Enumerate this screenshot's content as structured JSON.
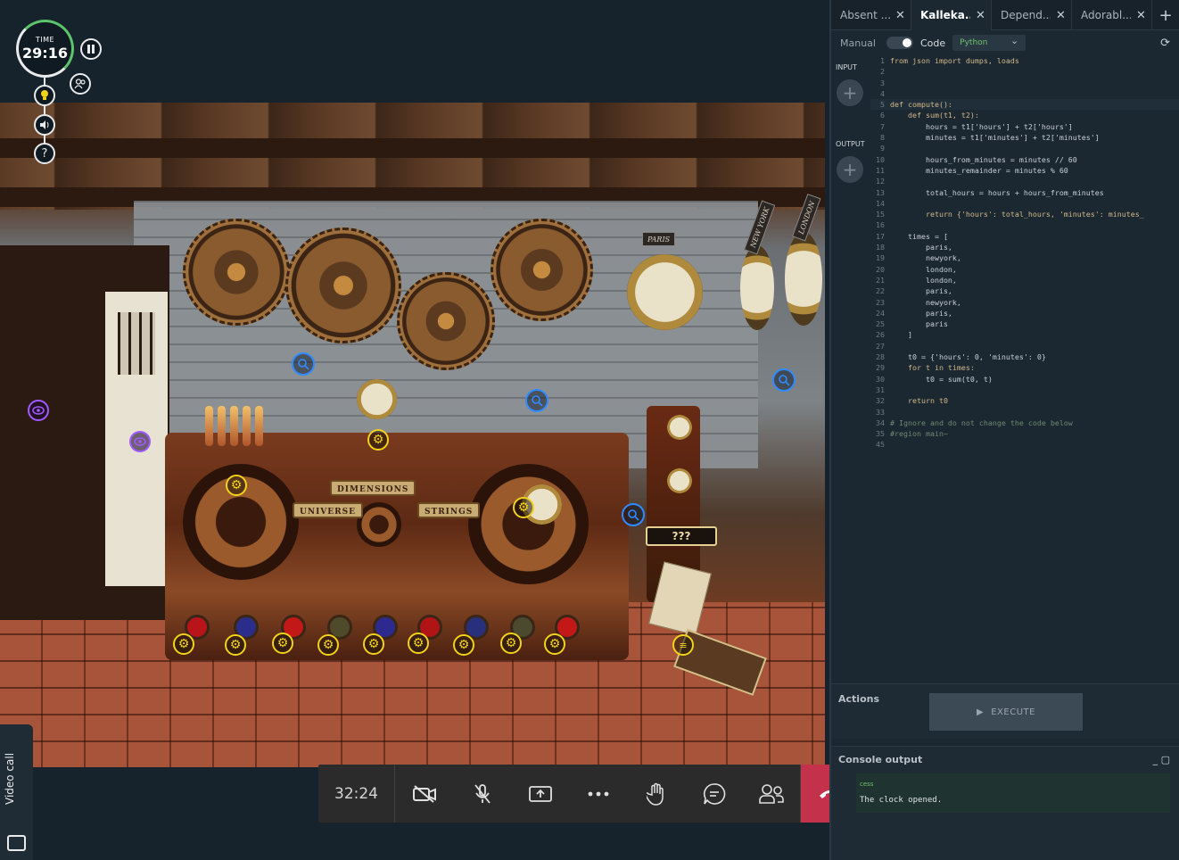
{
  "hud": {
    "timer_label": "TIME",
    "timer_value": "29:16",
    "pause_icon": "pause-icon",
    "team_icon": "team-icon",
    "hint_icon": "lightbulb-icon",
    "sound_icon": "speaker-icon",
    "help_label": "?"
  },
  "scene": {
    "signs": {
      "dimensions": "DIMENSIONS",
      "universe": "UNIVERSE",
      "strings": "STRINGS",
      "mystery": "???",
      "paris": "PARIS",
      "newyork": "NEW YORK",
      "london": "LONDON"
    },
    "gear_glyph": "⚙",
    "coin_glyph": "≡"
  },
  "video_call": {
    "tab_label": "Video call",
    "elapsed": "32:24",
    "buttons": [
      "camera-off-icon",
      "mic-off-icon",
      "share-screen-icon",
      "more-icon",
      "raise-hand-icon",
      "chat-icon",
      "participants-icon",
      "hang-up-icon"
    ]
  },
  "panel": {
    "tabs": [
      {
        "label": "Absent ...",
        "active": false
      },
      {
        "label": "Kalleka...",
        "active": true
      },
      {
        "label": "Depend...",
        "active": false
      },
      {
        "label": "Adorabl...",
        "active": false
      }
    ],
    "close_glyph": "✕",
    "add_tab_glyph": "+",
    "toolbar": {
      "manual_label": "Manual",
      "code_label": "Code",
      "language": "Python",
      "refresh_icon": "refresh-icon"
    },
    "io": {
      "input_label": "INPUT",
      "output_label": "OUTPUT",
      "add_glyph": "+"
    },
    "code_lines": [
      {
        "n": "1",
        "t": "from json import dumps, loads"
      },
      {
        "n": "2",
        "t": ""
      },
      {
        "n": "3",
        "t": ""
      },
      {
        "n": "4",
        "t": ""
      },
      {
        "n": "5",
        "t": "def compute():"
      },
      {
        "n": "6",
        "t": "    def sum(t1, t2):"
      },
      {
        "n": "7",
        "t": "        hours = t1['hours'] + t2['hours']"
      },
      {
        "n": "8",
        "t": "        minutes = t1['minutes'] + t2['minutes']"
      },
      {
        "n": "9",
        "t": ""
      },
      {
        "n": "10",
        "t": "        hours_from_minutes = minutes // 60"
      },
      {
        "n": "11",
        "t": "        minutes_remainder = minutes % 60"
      },
      {
        "n": "12",
        "t": ""
      },
      {
        "n": "13",
        "t": "        total_hours = hours + hours_from_minutes"
      },
      {
        "n": "14",
        "t": ""
      },
      {
        "n": "15",
        "t": "        return {'hours': total_hours, 'minutes': minutes_"
      },
      {
        "n": "16",
        "t": ""
      },
      {
        "n": "17",
        "t": "    times = ["
      },
      {
        "n": "18",
        "t": "        paris,"
      },
      {
        "n": "19",
        "t": "        newyork,"
      },
      {
        "n": "20",
        "t": "        london,"
      },
      {
        "n": "21",
        "t": "        london,"
      },
      {
        "n": "22",
        "t": "        paris,"
      },
      {
        "n": "23",
        "t": "        newyork,"
      },
      {
        "n": "24",
        "t": "        paris,"
      },
      {
        "n": "25",
        "t": "        paris"
      },
      {
        "n": "26",
        "t": "    ]"
      },
      {
        "n": "27",
        "t": ""
      },
      {
        "n": "28",
        "t": "    t0 = {'hours': 0, 'minutes': 0}"
      },
      {
        "n": "29",
        "t": "    for t in times:"
      },
      {
        "n": "30",
        "t": "        t0 = sum(t0, t)"
      },
      {
        "n": "31",
        "t": ""
      },
      {
        "n": "32",
        "t": "    return t0"
      },
      {
        "n": "33",
        "t": ""
      },
      {
        "n": "34",
        "t": "# Ignore and do not change the code below"
      },
      {
        "n": "35",
        "t": "#region main~"
      },
      {
        "n": "45",
        "t": ""
      }
    ],
    "actions": {
      "label": "Actions",
      "execute_label": "EXECUTE"
    },
    "console": {
      "label": "Console output",
      "status": "cess",
      "message": "The clock opened."
    }
  },
  "colors": {
    "hangup": "#c4314b",
    "gear_hotspot": "#f2d21a",
    "search_hotspot": "#2f8bff",
    "eye_hotspot": "#a259ff",
    "timer_progress": "#5cc46a"
  }
}
